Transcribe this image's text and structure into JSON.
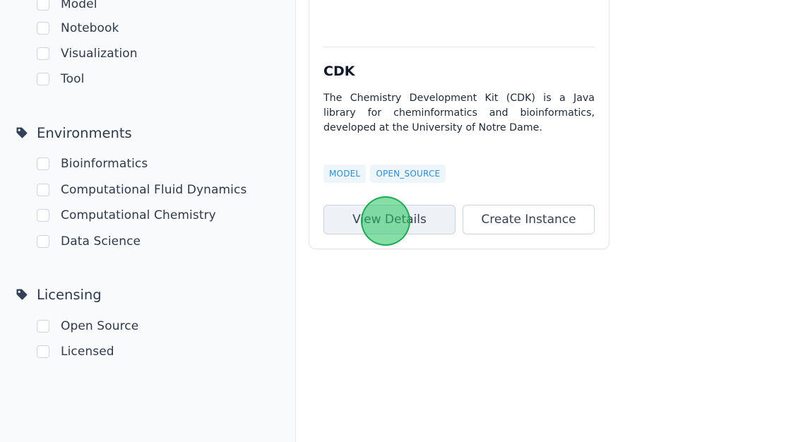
{
  "sidebar": {
    "type_items": [
      "Model",
      "Notebook",
      "Visualization",
      "Tool"
    ],
    "environments": {
      "title": "Environments",
      "items": [
        "Bioinformatics",
        "Computational Fluid Dynamics",
        "Computational Chemistry",
        "Data Science"
      ]
    },
    "licensing": {
      "title": "Licensing",
      "items": [
        "Open Source",
        "Licensed"
      ]
    }
  },
  "card": {
    "title": "CDK",
    "description": "The Chemistry Development Kit (CDK) is a Java library for cheminformatics and bioinformatics, developed at the University of Notre Dame.",
    "badges": [
      "MODEL",
      "OPEN_SOURCE"
    ],
    "view_label": "View Details",
    "create_label": "Create Instance"
  },
  "colors": {
    "accent": "#2d8ecf",
    "badge_bg": "#eef6fc",
    "click_marker": "#22c55e"
  }
}
